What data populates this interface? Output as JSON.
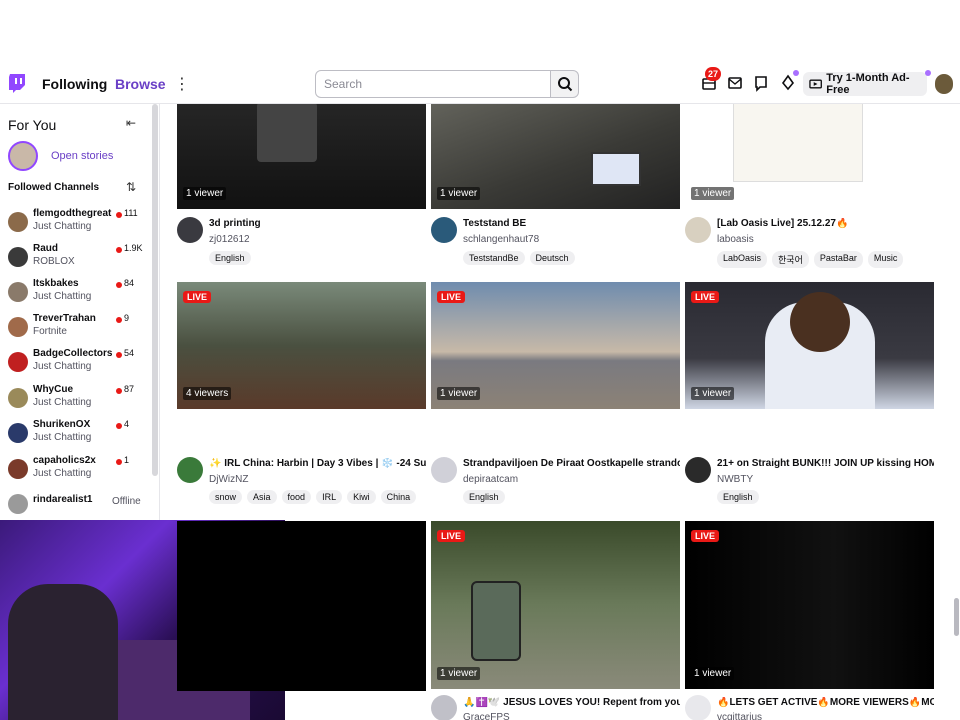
{
  "nav": {
    "following": "Following",
    "browse": "Browse",
    "search_placeholder": "Search",
    "notifications_badge": "27",
    "ad_free": "Try 1-Month Ad-Free"
  },
  "sidebar": {
    "title": "For You",
    "open_stories": "Open stories",
    "followed_header": "Followed Channels",
    "channels": [
      {
        "name": "flemgodthegreat",
        "category": "Just Chatting",
        "viewers": "111",
        "live": true,
        "color": "#8b6a4a"
      },
      {
        "name": "Raud",
        "category": "ROBLOX",
        "viewers": "1.9K",
        "live": true,
        "color": "#3a3a3a"
      },
      {
        "name": "Itskbakes",
        "category": "Just Chatting",
        "viewers": "84",
        "live": true,
        "color": "#8a7a6a"
      },
      {
        "name": "TreverTrahan",
        "category": "Fortnite",
        "viewers": "9",
        "live": true,
        "color": "#a06a4a"
      },
      {
        "name": "BadgeCollectors",
        "category": "Just Chatting",
        "viewers": "54",
        "live": true,
        "color": "#c02020"
      },
      {
        "name": "WhyCue",
        "category": "Just Chatting",
        "viewers": "87",
        "live": true,
        "color": "#9a8a5a"
      },
      {
        "name": "ShurikenOX",
        "category": "Just Chatting",
        "viewers": "4",
        "live": true,
        "color": "#2a3a6a"
      },
      {
        "name": "capaholics2x",
        "category": "Just Chatting",
        "viewers": "1",
        "live": true,
        "color": "#7a3a2a"
      },
      {
        "name": "rindarealist1",
        "category": "",
        "viewers": "Offline",
        "live": false,
        "color": "#9a9a9a"
      }
    ]
  },
  "cards": [
    {
      "live": "",
      "viewers": "1 viewer",
      "title": "3d printing",
      "channel": "zj012612",
      "tags": [
        "English"
      ],
      "thumb": "#1a1a1a",
      "avatar": "#3a3a40"
    },
    {
      "live": "",
      "viewers": "1 viewer",
      "title": "Teststand BE",
      "channel": "schlangenhaut78",
      "tags": [
        "TeststandBe",
        "Deutsch"
      ],
      "thumb": "#5a5a52",
      "avatar": "#2a5a7a"
    },
    {
      "live": "",
      "viewers": "1 viewer",
      "title": "[Lab Oasis Live] 25.12.27🔥",
      "channel": "laboasis",
      "tags": [
        "LabOasis",
        "한국어",
        "PastaBar",
        "Music"
      ],
      "thumb": "#f2f0ea",
      "avatar": "#d8d0c0"
    },
    {
      "live": "LIVE",
      "viewers": "4 viewers",
      "title": "✨ IRL China: Harbin | Day 3 Vibes | ❄️ -24 Su...",
      "channel": "DjWizNZ",
      "tags": [
        "snow",
        "Asia",
        "food",
        "IRL",
        "Kiwi",
        "China"
      ],
      "thumb": "#4a5a4a",
      "avatar": "#3a7a3a"
    },
    {
      "live": "LIVE",
      "viewers": "1 viewer",
      "title": "Strandpaviljoen De Piraat Oostkapelle strandc...",
      "channel": "depiraatcam",
      "tags": [
        "English"
      ],
      "thumb": "#9aa4b0",
      "avatar": "#d0d0d8"
    },
    {
      "live": "LIVE",
      "viewers": "1 viewer",
      "title": "21+ on Straight BUNK!!! JOIN UP kissing HOM...",
      "channel": "NWBTY",
      "tags": [
        "English"
      ],
      "thumb": "#3a3a42",
      "avatar": "#2a2a2a"
    },
    {
      "live": "",
      "viewers": "",
      "title": "",
      "channel": "",
      "tags": [],
      "thumb": "#000000",
      "avatar": "#ffffff"
    },
    {
      "live": "LIVE",
      "viewers": "1 viewer",
      "title": "🙏✝️🕊️ JESUS LOVES YOU! Repent from you...",
      "channel": "GraceFPS",
      "tags": [],
      "thumb": "#5a6a4a",
      "avatar": "#c0c0c8"
    },
    {
      "live": "LIVE",
      "viewers": "1 viewer",
      "title": "🔥LETS GET ACTIVE🔥MORE VIEWERS🔥MO...",
      "channel": "vcgittarius",
      "tags": [],
      "thumb": "#000000",
      "avatar": "#e8e8ec"
    }
  ]
}
